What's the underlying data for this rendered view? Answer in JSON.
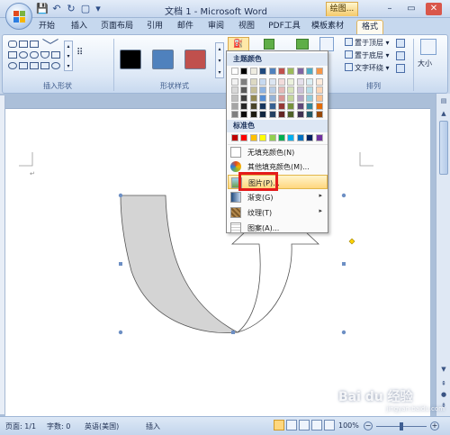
{
  "window": {
    "title": "文档 1 - Microsoft Word",
    "contextual_tab": "绘图...",
    "controls": [
      "–",
      "▭",
      "✕"
    ]
  },
  "tabs": [
    {
      "label": "开始",
      "active": false
    },
    {
      "label": "插入",
      "active": false
    },
    {
      "label": "页面布局",
      "active": false
    },
    {
      "label": "引用",
      "active": false
    },
    {
      "label": "邮件",
      "active": false
    },
    {
      "label": "审阅",
      "active": false
    },
    {
      "label": "视图",
      "active": false
    },
    {
      "label": "PDF工具",
      "active": false
    },
    {
      "label": "模板素材",
      "active": false
    },
    {
      "label": "格式",
      "active": true
    }
  ],
  "ribbon": {
    "groups": {
      "insert_shapes": "插入形状",
      "shape_styles": "形状样式",
      "arrange": "排列"
    },
    "style_swatch_colors": [
      "#000000",
      "#4f81bd",
      "#c0504d"
    ],
    "arrange_buttons": [
      {
        "label": "置于顶层",
        "icon": "bring-front-icon"
      },
      {
        "label": "置于底层",
        "icon": "send-back-icon"
      },
      {
        "label": "文字环绕",
        "icon": "text-wrap-icon"
      }
    ],
    "size_label": "大小"
  },
  "fill_menu": {
    "theme_colors_header": "主题颜色",
    "theme_top_row": [
      "#ffffff",
      "#000000",
      "#eeece1",
      "#1f497d",
      "#4f81bd",
      "#c0504d",
      "#9bbb59",
      "#8064a2",
      "#4bacc6",
      "#f79646"
    ],
    "theme_columns": [
      [
        "#f2f2f2",
        "#d8d8d8",
        "#bfbfbf",
        "#a5a5a5",
        "#7f7f7f"
      ],
      [
        "#7f7f7f",
        "#595959",
        "#3f3f3f",
        "#262626",
        "#0c0c0c"
      ],
      [
        "#ddd9c3",
        "#c4bd97",
        "#938953",
        "#494429",
        "#1d1b10"
      ],
      [
        "#c6d9f0",
        "#8db3e2",
        "#548dd4",
        "#17365d",
        "#0f243e"
      ],
      [
        "#dbe5f1",
        "#b8cce4",
        "#95b3d7",
        "#366092",
        "#244061"
      ],
      [
        "#f2dcdb",
        "#e5b9b7",
        "#d99694",
        "#953734",
        "#632423"
      ],
      [
        "#ebf1dd",
        "#d7e3bc",
        "#c3d69b",
        "#76923c",
        "#4f6128"
      ],
      [
        "#e5e0ec",
        "#ccc1d9",
        "#b2a2c7",
        "#5f497a",
        "#3f3151"
      ],
      [
        "#dbeef3",
        "#b7dde8",
        "#92cddc",
        "#31859b",
        "#205867"
      ],
      [
        "#fdeada",
        "#fbd5b5",
        "#fac08f",
        "#e36c09",
        "#974806"
      ]
    ],
    "standard_colors_header": "标准色",
    "standard_colors": [
      "#c00000",
      "#ff0000",
      "#ffc000",
      "#ffff00",
      "#92d050",
      "#00b050",
      "#00b0f0",
      "#0070c0",
      "#002060",
      "#7030a0"
    ],
    "items": [
      {
        "label": "无填充颜色(N)",
        "icon": "no-fill-icon",
        "submenu": false
      },
      {
        "label": "其他填充颜色(M)...",
        "icon": "more-colors-icon",
        "submenu": false
      },
      {
        "label": "图片(P)...",
        "icon": "picture-icon",
        "submenu": false,
        "highlighted": true
      },
      {
        "label": "渐变(G)",
        "icon": "gradient-icon",
        "submenu": true
      },
      {
        "label": "纹理(T)",
        "icon": "texture-icon",
        "submenu": true
      },
      {
        "label": "图案(A)...",
        "icon": "pattern-icon",
        "submenu": false
      }
    ]
  },
  "status": {
    "page": "页面: 1/1",
    "words": "字数: 0",
    "language": "英语(美国)",
    "mode": "插入",
    "zoom": "100%"
  },
  "watermark": {
    "text": "Bai du 经验",
    "url": "jingyan.baidu.com"
  },
  "colors": {
    "accent_highlight": "#ffd77e",
    "red_box": "#e41b1b",
    "shape_fill": "#d4d4d4"
  }
}
